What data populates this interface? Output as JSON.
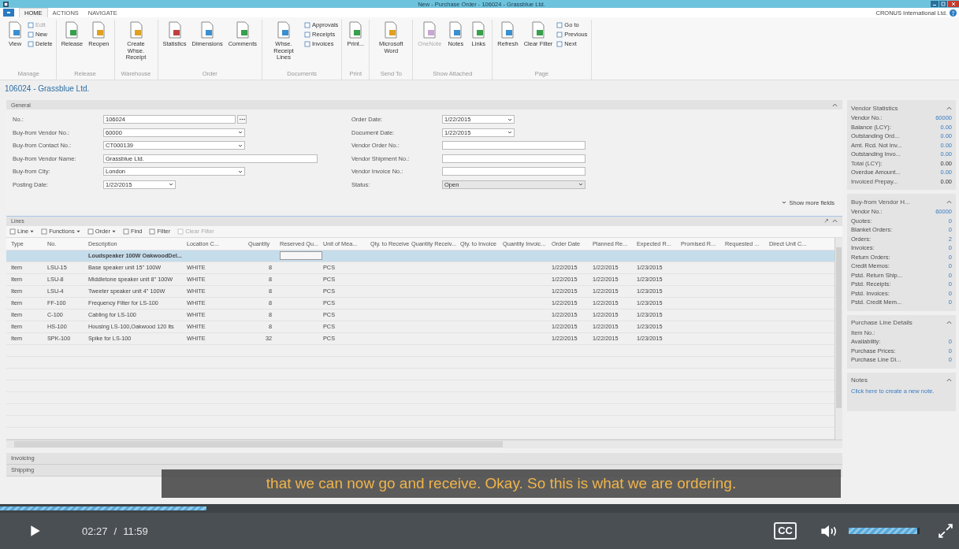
{
  "window": {
    "title": "New - Purchase Order - 106024 - Grassblue Ltd.",
    "company": "CRONUS International Ltd."
  },
  "ribbon_tabs": [
    {
      "label": "HOME",
      "selected": true
    },
    {
      "label": "ACTIONS",
      "selected": false
    },
    {
      "label": "NAVIGATE",
      "selected": false
    }
  ],
  "ribbon_groups": [
    {
      "label": "Manage",
      "items": [
        {
          "label": "View",
          "kind": "large",
          "disabled": false
        },
        {
          "label": "Edit",
          "kind": "small",
          "disabled": true
        },
        {
          "label": "New",
          "kind": "small",
          "disabled": false
        },
        {
          "label": "Delete",
          "kind": "small",
          "disabled": false
        }
      ]
    },
    {
      "label": "Release",
      "items": [
        {
          "label": "Release",
          "kind": "large",
          "disabled": false
        },
        {
          "label": "Reopen",
          "kind": "large",
          "disabled": false
        }
      ]
    },
    {
      "label": "Warehouse",
      "items": [
        {
          "label": "Create Whse. Receipt",
          "kind": "large",
          "disabled": false
        }
      ]
    },
    {
      "label": "Order",
      "items": [
        {
          "label": "Statistics",
          "kind": "large",
          "disabled": false
        },
        {
          "label": "Dimensions",
          "kind": "large",
          "disabled": false
        },
        {
          "label": "Comments",
          "kind": "large",
          "disabled": false
        }
      ]
    },
    {
      "label": "Documents",
      "items": [
        {
          "label": "Whse. Receipt Lines",
          "kind": "large",
          "disabled": false
        },
        {
          "label": "Approvals",
          "kind": "small",
          "disabled": false
        },
        {
          "label": "Receipts",
          "kind": "small",
          "disabled": false
        },
        {
          "label": "Invoices",
          "kind": "small",
          "disabled": false
        }
      ]
    },
    {
      "label": "Print",
      "items": [
        {
          "label": "Print...",
          "kind": "large",
          "disabled": false
        }
      ]
    },
    {
      "label": "Send To",
      "items": [
        {
          "label": "Microsoft Word",
          "kind": "large",
          "disabled": false
        }
      ]
    },
    {
      "label": "Show Attached",
      "items": [
        {
          "label": "OneNote",
          "kind": "large",
          "disabled": true
        },
        {
          "label": "Notes",
          "kind": "large",
          "disabled": false
        },
        {
          "label": "Links",
          "kind": "large",
          "disabled": false
        }
      ]
    },
    {
      "label": "Page",
      "items": [
        {
          "label": "Refresh",
          "kind": "large",
          "disabled": false
        },
        {
          "label": "Clear Filter",
          "kind": "large",
          "disabled": false
        },
        {
          "label": "Go to",
          "kind": "small",
          "disabled": false
        },
        {
          "label": "Previous",
          "kind": "small",
          "disabled": false
        },
        {
          "label": "Next",
          "kind": "small",
          "disabled": false
        }
      ]
    }
  ],
  "page_title": "106024 - Grassblue Ltd.",
  "general": {
    "title": "General",
    "show_more": "Show more fields",
    "left_fields": [
      {
        "label": "No.:",
        "value": "106024",
        "kind": "lookup"
      },
      {
        "label": "Buy-from Vendor No.:",
        "value": "60000",
        "kind": "dropdown"
      },
      {
        "label": "Buy-from Contact No.:",
        "value": "CT000139",
        "kind": "dropdown"
      },
      {
        "label": "Buy-from Vendor Name:",
        "value": "Grassblue Ltd.",
        "kind": "text"
      },
      {
        "label": "Buy-from City:",
        "value": "London",
        "kind": "dropdown"
      },
      {
        "label": "Posting Date:",
        "value": "1/22/2015",
        "kind": "date"
      }
    ],
    "right_fields": [
      {
        "label": "Order Date:",
        "value": "1/22/2015",
        "kind": "date"
      },
      {
        "label": "Document Date:",
        "value": "1/22/2015",
        "kind": "date"
      },
      {
        "label": "Vendor Order No.:",
        "kind": "text"
      },
      {
        "label": "Vendor Shipment No.:",
        "kind": "text"
      },
      {
        "label": "Vendor Invoice No.:",
        "kind": "text"
      },
      {
        "label": "Status:",
        "value": "Open",
        "kind": "status"
      }
    ]
  },
  "lines": {
    "title": "Lines",
    "toolbar": [
      {
        "label": "Line",
        "menu": true,
        "disabled": false
      },
      {
        "label": "Functions",
        "menu": true,
        "disabled": false
      },
      {
        "label": "Order",
        "menu": true,
        "disabled": false
      },
      {
        "label": "Find",
        "menu": false,
        "disabled": false
      },
      {
        "label": "Filter",
        "menu": false,
        "disabled": false
      },
      {
        "label": "Clear Filter",
        "menu": false,
        "disabled": true
      }
    ],
    "columns": [
      "Type",
      "No.",
      "Description",
      "Location C...",
      "Quantity",
      "Reserved Qu...",
      "Unit of Mea...",
      "Qty. to Receive",
      "Quantity Receiv...",
      "Qty. to Invoice",
      "Quantity Invoic...",
      "Order Date",
      "Planned Re...",
      "Expected R...",
      "Promised R...",
      "Requested ...",
      "Direct Unit C..."
    ],
    "rows": [
      {
        "selected": true,
        "description": "Loudspeaker 100W OakwoodDel..."
      },
      {
        "selected": false,
        "type": "Item",
        "no": "LSU-15",
        "description": "Base speaker unit 15\" 100W",
        "location": "WHITE",
        "quantity": "8",
        "unit": "PCS",
        "order_date": "1/22/2015",
        "planned_date": "1/22/2015",
        "expected_date": "1/23/2015"
      },
      {
        "selected": false,
        "type": "Item",
        "no": "LSU-8",
        "description": "Middletone speaker unit 8\" 100W",
        "location": "WHITE",
        "quantity": "8",
        "unit": "PCS",
        "order_date": "1/22/2015",
        "planned_date": "1/22/2015",
        "expected_date": "1/23/2015"
      },
      {
        "selected": false,
        "type": "Item",
        "no": "LSU-4",
        "description": "Tweeter speaker unit 4\" 100W",
        "location": "WHITE",
        "quantity": "8",
        "unit": "PCS",
        "order_date": "1/22/2015",
        "planned_date": "1/22/2015",
        "expected_date": "1/23/2015"
      },
      {
        "selected": false,
        "type": "Item",
        "no": "FF-100",
        "description": "Frequency Filter for LS-100",
        "location": "WHITE",
        "quantity": "8",
        "unit": "PCS",
        "order_date": "1/22/2015",
        "planned_date": "1/22/2015",
        "expected_date": "1/23/2015"
      },
      {
        "selected": false,
        "type": "Item",
        "no": "C-100",
        "description": "Cabling for LS-100",
        "location": "WHITE",
        "quantity": "8",
        "unit": "PCS",
        "order_date": "1/22/2015",
        "planned_date": "1/22/2015",
        "expected_date": "1/23/2015"
      },
      {
        "selected": false,
        "type": "Item",
        "no": "HS-100",
        "description": "Housing LS-100,Oakwood 120 lts",
        "location": "WHITE",
        "quantity": "8",
        "unit": "PCS",
        "order_date": "1/22/2015",
        "planned_date": "1/22/2015",
        "expected_date": "1/23/2015"
      },
      {
        "selected": false,
        "type": "Item",
        "no": "SPK-100",
        "description": "Spike for LS-100",
        "location": "WHITE",
        "quantity": "32",
        "unit": "PCS",
        "order_date": "1/22/2015",
        "planned_date": "1/22/2015",
        "expected_date": "1/23/2015"
      }
    ]
  },
  "collapsed_sections": [
    "Invoicing",
    "Shipping"
  ],
  "factboxes": [
    {
      "title": "Vendor Statistics",
      "rows": [
        {
          "label": "Vendor No.:",
          "value": "60000",
          "link": true
        },
        {
          "label": "Balance (LCY):",
          "value": "0.00",
          "link": true
        },
        {
          "label": "Outstanding Ord...",
          "value": "0.00",
          "link": true
        },
        {
          "label": "Amt. Rcd. Not Inv...",
          "value": "0.00",
          "link": true
        },
        {
          "label": "Outstanding Invo...",
          "value": "0.00",
          "link": true
        },
        {
          "label": "Total (LCY):",
          "value": "0.00",
          "link": false
        },
        {
          "label": "Overdue Amount...",
          "value": "0.00",
          "link": true
        },
        {
          "label": "Invoiced Prepay...",
          "value": "0.00",
          "link": false
        }
      ]
    },
    {
      "title": "Buy-from Vendor H...",
      "rows": [
        {
          "label": "Vendor No.:",
          "value": "60000",
          "link": true
        },
        {
          "label": "Quotes:",
          "value": "0",
          "link": true
        },
        {
          "label": "Blanket Orders:",
          "value": "0",
          "link": true
        },
        {
          "label": "Orders:",
          "value": "2",
          "link": true
        },
        {
          "label": "Invoices:",
          "value": "0",
          "link": true
        },
        {
          "label": "Return Orders:",
          "value": "0",
          "link": true
        },
        {
          "label": "Credit Memos:",
          "value": "0",
          "link": true
        },
        {
          "label": "Pstd. Return Ship...",
          "value": "0",
          "link": true
        },
        {
          "label": "Pstd. Receipts:",
          "value": "0",
          "link": true
        },
        {
          "label": "Pstd. Invoices:",
          "value": "0",
          "link": true
        },
        {
          "label": "Pstd. Credit Mem...",
          "value": "0",
          "link": true
        }
      ]
    },
    {
      "title": "Purchase Line Details",
      "rows": [
        {
          "label": "Item No.:"
        },
        {
          "label": "Availability:",
          "value": "0",
          "link": true
        },
        {
          "label": "Purchase Prices:",
          "value": "0",
          "link": true
        },
        {
          "label": "Purchase Line Di...",
          "value": "0",
          "link": true
        }
      ]
    },
    {
      "title": "Notes",
      "note_link": "Click here to create a new note."
    }
  ],
  "player": {
    "caption": "that we can now go and receive. Okay. So this is what we are ordering.",
    "progress": {
      "level": 0.215
    },
    "current_time": "02:27",
    "separator": "/",
    "duration": "11:59",
    "cc_label": "CC",
    "volume": {
      "level": 0.97
    }
  }
}
